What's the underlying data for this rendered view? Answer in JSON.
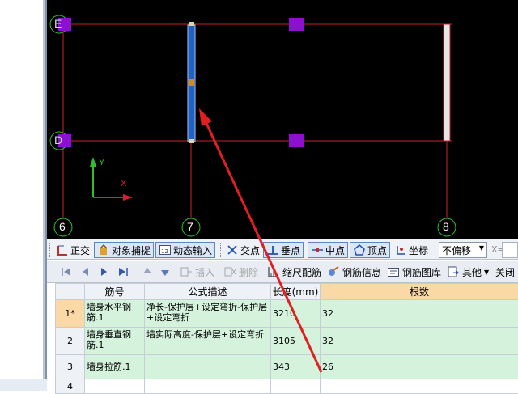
{
  "cad": {
    "axis_labels": {
      "row_e": "E",
      "row_d": "D",
      "col_6": "6",
      "col_7": "7",
      "col_8": "8"
    },
    "ucs": {
      "y": "Y",
      "x": "X"
    },
    "colors": {
      "gridline": "#c8242a",
      "marker": "#8b10d0",
      "axis_circle": "#2fbf2f",
      "wall": "#1f62c4",
      "arrow": "#e02020"
    }
  },
  "snapbar": {
    "ortho": "正交",
    "object_snap": "对象捕捉",
    "dynamic_input": "动态输入",
    "intersection": "交点",
    "perpendicular": "垂点",
    "midpoint": "中点",
    "vertex": "顶点",
    "coordinate": "坐标",
    "offset_select": "不偏移",
    "x_label": "X="
  },
  "toolbar": {
    "insert": "插入",
    "delete": "删除",
    "scale_rebar": "缩尺配筋",
    "rebar_info": "钢筋信息",
    "rebar_library": "钢筋图库",
    "other": "其他",
    "close": "关闭"
  },
  "grid": {
    "headers": {
      "rebar_no": "筋号",
      "formula": "公式描述",
      "length": "长度(mm)",
      "count": "根数"
    },
    "rows": [
      {
        "index": "1*",
        "name": "墙身水平钢筋.1",
        "formula": "净长-保护层+设定弯折-保护层+设定弯折",
        "length": "3210",
        "count": "32"
      },
      {
        "index": "2",
        "name": "墙身垂直钢筋.1",
        "formula": "墙实际高度-保护层+设定弯折",
        "length": "3105",
        "count": "32"
      },
      {
        "index": "3",
        "name": "墙身拉筋.1",
        "formula": "",
        "length": "343",
        "count": "26"
      },
      {
        "index": "4",
        "name": "",
        "formula": "",
        "length": "",
        "count": ""
      }
    ]
  }
}
